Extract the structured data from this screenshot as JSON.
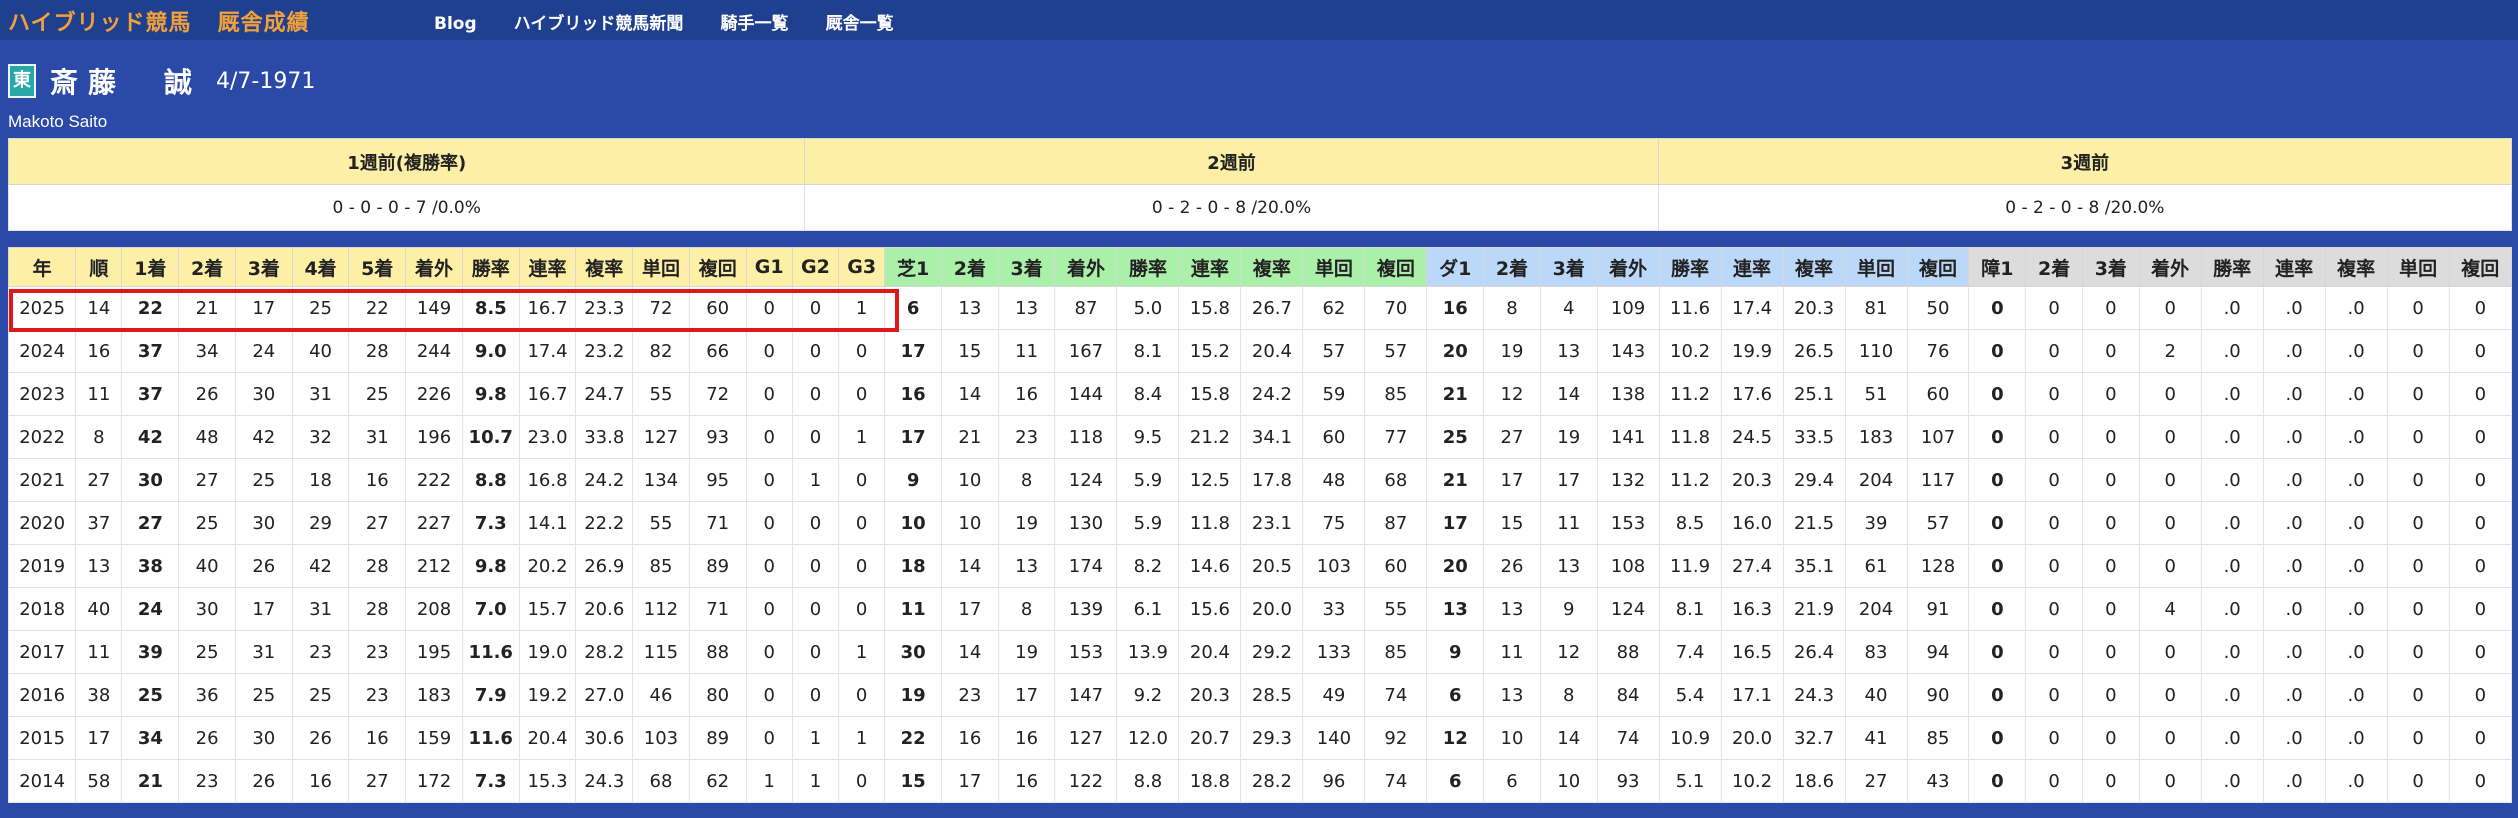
{
  "header": {
    "site_title": "ハイブリッド競馬",
    "section_title": "厩舎成績",
    "nav": [
      "Blog",
      "ハイブリッド競馬新聞",
      "騎手一覧",
      "厩舎一覧"
    ]
  },
  "jockey": {
    "affiliation": "東",
    "name": "斎藤　誠",
    "birthdate": "4/7-1971",
    "name_roman": "Makoto Saito"
  },
  "recent": {
    "headers": [
      "1週前(複勝率)",
      "2週前",
      "3週前"
    ],
    "values": [
      "0 - 0 - 0 - 7 /0.0%",
      "0 - 2 - 0 - 8 /20.0%",
      "0 - 2 - 0 - 8 /20.0%"
    ]
  },
  "stats": {
    "headers": [
      "年",
      "順",
      "1着",
      "2着",
      "3着",
      "4着",
      "5着",
      "着外",
      "勝率",
      "連率",
      "複率",
      "単回",
      "複回",
      "G1",
      "G2",
      "G3",
      "芝1",
      "2着",
      "3着",
      "着外",
      "勝率",
      "連率",
      "複率",
      "単回",
      "複回",
      "ダ1",
      "2着",
      "3着",
      "着外",
      "勝率",
      "連率",
      "複率",
      "単回",
      "複回",
      "障1",
      "2着",
      "3着",
      "着外",
      "勝率",
      "連率",
      "複率",
      "単回",
      "複回"
    ],
    "highlighted_row": "2025",
    "rows": [
      [
        "2025",
        "14",
        "22",
        "21",
        "17",
        "25",
        "22",
        "149",
        "8.5",
        "16.7",
        "23.3",
        "72",
        "60",
        "0",
        "0",
        "1",
        "6",
        "13",
        "13",
        "87",
        "5.0",
        "15.8",
        "26.7",
        "62",
        "70",
        "16",
        "8",
        "4",
        "109",
        "11.6",
        "17.4",
        "20.3",
        "81",
        "50",
        "0",
        "0",
        "0",
        "0",
        ".0",
        ".0",
        ".0",
        "0",
        "0"
      ],
      [
        "2024",
        "16",
        "37",
        "34",
        "24",
        "40",
        "28",
        "244",
        "9.0",
        "17.4",
        "23.2",
        "82",
        "66",
        "0",
        "0",
        "0",
        "17",
        "15",
        "11",
        "167",
        "8.1",
        "15.2",
        "20.4",
        "57",
        "57",
        "20",
        "19",
        "13",
        "143",
        "10.2",
        "19.9",
        "26.5",
        "110",
        "76",
        "0",
        "0",
        "0",
        "2",
        ".0",
        ".0",
        ".0",
        "0",
        "0"
      ],
      [
        "2023",
        "11",
        "37",
        "26",
        "30",
        "31",
        "25",
        "226",
        "9.8",
        "16.7",
        "24.7",
        "55",
        "72",
        "0",
        "0",
        "0",
        "16",
        "14",
        "16",
        "144",
        "8.4",
        "15.8",
        "24.2",
        "59",
        "85",
        "21",
        "12",
        "14",
        "138",
        "11.2",
        "17.6",
        "25.1",
        "51",
        "60",
        "0",
        "0",
        "0",
        "0",
        ".0",
        ".0",
        ".0",
        "0",
        "0"
      ],
      [
        "2022",
        "8",
        "42",
        "48",
        "42",
        "32",
        "31",
        "196",
        "10.7",
        "23.0",
        "33.8",
        "127",
        "93",
        "0",
        "0",
        "1",
        "17",
        "21",
        "23",
        "118",
        "9.5",
        "21.2",
        "34.1",
        "60",
        "77",
        "25",
        "27",
        "19",
        "141",
        "11.8",
        "24.5",
        "33.5",
        "183",
        "107",
        "0",
        "0",
        "0",
        "0",
        ".0",
        ".0",
        ".0",
        "0",
        "0"
      ],
      [
        "2021",
        "27",
        "30",
        "27",
        "25",
        "18",
        "16",
        "222",
        "8.8",
        "16.8",
        "24.2",
        "134",
        "95",
        "0",
        "1",
        "0",
        "9",
        "10",
        "8",
        "124",
        "5.9",
        "12.5",
        "17.8",
        "48",
        "68",
        "21",
        "17",
        "17",
        "132",
        "11.2",
        "20.3",
        "29.4",
        "204",
        "117",
        "0",
        "0",
        "0",
        "0",
        ".0",
        ".0",
        ".0",
        "0",
        "0"
      ],
      [
        "2020",
        "37",
        "27",
        "25",
        "30",
        "29",
        "27",
        "227",
        "7.3",
        "14.1",
        "22.2",
        "55",
        "71",
        "0",
        "0",
        "0",
        "10",
        "10",
        "19",
        "130",
        "5.9",
        "11.8",
        "23.1",
        "75",
        "87",
        "17",
        "15",
        "11",
        "153",
        "8.5",
        "16.0",
        "21.5",
        "39",
        "57",
        "0",
        "0",
        "0",
        "0",
        ".0",
        ".0",
        ".0",
        "0",
        "0"
      ],
      [
        "2019",
        "13",
        "38",
        "40",
        "26",
        "42",
        "28",
        "212",
        "9.8",
        "20.2",
        "26.9",
        "85",
        "89",
        "0",
        "0",
        "0",
        "18",
        "14",
        "13",
        "174",
        "8.2",
        "14.6",
        "20.5",
        "103",
        "60",
        "20",
        "26",
        "13",
        "108",
        "11.9",
        "27.4",
        "35.1",
        "61",
        "128",
        "0",
        "0",
        "0",
        "0",
        ".0",
        ".0",
        ".0",
        "0",
        "0"
      ],
      [
        "2018",
        "40",
        "24",
        "30",
        "17",
        "31",
        "28",
        "208",
        "7.0",
        "15.7",
        "20.6",
        "112",
        "71",
        "0",
        "0",
        "0",
        "11",
        "17",
        "8",
        "139",
        "6.1",
        "15.6",
        "20.0",
        "33",
        "55",
        "13",
        "13",
        "9",
        "124",
        "8.1",
        "16.3",
        "21.9",
        "204",
        "91",
        "0",
        "0",
        "0",
        "4",
        ".0",
        ".0",
        ".0",
        "0",
        "0"
      ],
      [
        "2017",
        "11",
        "39",
        "25",
        "31",
        "23",
        "23",
        "195",
        "11.6",
        "19.0",
        "28.2",
        "115",
        "88",
        "0",
        "0",
        "1",
        "30",
        "14",
        "19",
        "153",
        "13.9",
        "20.4",
        "29.2",
        "133",
        "85",
        "9",
        "11",
        "12",
        "88",
        "7.4",
        "16.5",
        "26.4",
        "83",
        "94",
        "0",
        "0",
        "0",
        "0",
        ".0",
        ".0",
        ".0",
        "0",
        "0"
      ],
      [
        "2016",
        "38",
        "25",
        "36",
        "25",
        "25",
        "23",
        "183",
        "7.9",
        "19.2",
        "27.0",
        "46",
        "80",
        "0",
        "0",
        "0",
        "19",
        "23",
        "17",
        "147",
        "9.2",
        "20.3",
        "28.5",
        "49",
        "74",
        "6",
        "13",
        "8",
        "84",
        "5.4",
        "17.1",
        "24.3",
        "40",
        "90",
        "0",
        "0",
        "0",
        "0",
        ".0",
        ".0",
        ".0",
        "0",
        "0"
      ],
      [
        "2015",
        "17",
        "34",
        "26",
        "30",
        "26",
        "16",
        "159",
        "11.6",
        "20.4",
        "30.6",
        "103",
        "89",
        "0",
        "1",
        "1",
        "22",
        "16",
        "16",
        "127",
        "12.0",
        "20.7",
        "29.3",
        "140",
        "92",
        "12",
        "10",
        "14",
        "74",
        "10.9",
        "20.0",
        "32.7",
        "41",
        "85",
        "0",
        "0",
        "0",
        "0",
        ".0",
        ".0",
        ".0",
        "0",
        "0"
      ],
      [
        "2014",
        "58",
        "21",
        "23",
        "26",
        "16",
        "27",
        "172",
        "7.3",
        "15.3",
        "24.3",
        "68",
        "62",
        "1",
        "1",
        "0",
        "15",
        "17",
        "16",
        "122",
        "8.8",
        "18.8",
        "28.2",
        "96",
        "74",
        "6",
        "6",
        "10",
        "93",
        "5.1",
        "10.2",
        "18.6",
        "27",
        "43",
        "0",
        "0",
        "0",
        "0",
        ".0",
        ".0",
        ".0",
        "0",
        "0"
      ]
    ]
  },
  "colors": {
    "background": "#2b4aa8",
    "brand": "#f2a13a",
    "header_yellow": "#fdf0a6",
    "turf_green": "#aaf0a8",
    "dirt_blue": "#bcd8f8",
    "hurdle_gray": "#dcdcdc",
    "highlight_red": "#e01818"
  }
}
